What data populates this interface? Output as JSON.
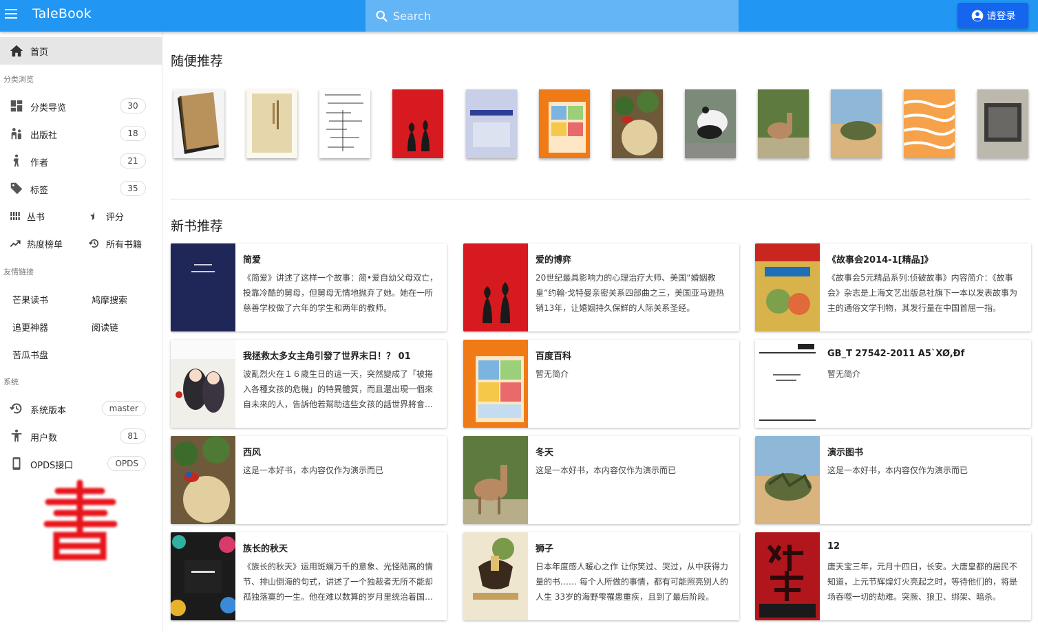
{
  "app": {
    "title": "TaleBook"
  },
  "search": {
    "placeholder": "Search"
  },
  "header": {
    "login_label": "请登录"
  },
  "sidebar": {
    "home_label": "首页",
    "browse_header": "分类浏览",
    "browse_items": [
      {
        "label": "分类导览",
        "count": "30"
      },
      {
        "label": "出版社",
        "count": "18"
      },
      {
        "label": "作者",
        "count": "21"
      },
      {
        "label": "标签",
        "count": "35"
      }
    ],
    "series_label": "丛书",
    "rating_label": "评分",
    "hot_label": "热度榜单",
    "all_books_label": "所有书籍",
    "links_header": "友情链接",
    "links": [
      "芒果读书",
      "鸠摩搜索",
      "追更神器",
      "阅读链",
      "苦瓜书盘"
    ],
    "system_header": "系统",
    "system_items": [
      {
        "label": "系统版本",
        "value": "master"
      },
      {
        "label": "用户数",
        "value": "81"
      },
      {
        "label": "OPDS接口",
        "value": "OPDS"
      }
    ],
    "seal_text": "書"
  },
  "random": {
    "title": "随便推荐",
    "covers": [
      "brown-book",
      "tan-book",
      "document-scan",
      "red-chess",
      "blue-textbook",
      "comic-almanac",
      "bird-flowers",
      "panda",
      "deer",
      "desert-plant",
      "orange-stripes",
      "grey-photo"
    ]
  },
  "newbooks": {
    "title": "新书推荐",
    "books": [
      {
        "title": "简爱",
        "desc": "《简爱》讲述了这样一个故事：简•爱自幼父母双亡，投靠冷酷的舅母，但舅母无情地抛弃了她。她在一所慈善学校做了六年的学生和两年的教师。"
      },
      {
        "title": "爱的博弈",
        "desc": "20世纪最具影响力的心理治疗大师、美国“婚姻教皇”约翰·戈特曼亲密关系四部曲之三，美国亚马逊热销13年，让婚姻持久保鲜的人际关系圣经。"
      },
      {
        "title": "《故事会2014-1[精品]》",
        "desc": "《故事会5元精品系列:侦破故事》内容简介：《故事会》杂志是上海文艺出版总社旗下一本以发表故事为主的通俗文学刊物，其发行量在中国首屈一指。"
      },
      {
        "title": "我拯救太多女主角引發了世界末日！？ 01",
        "desc": "波亂烈火在１６歲生日的這一天，突然變成了「被捲入各種女孩的危機」的特異體質，而且還出現一個來自未來的人，告訴他若幫助這些女孩的話世界將會毀滅。"
      },
      {
        "title": "百度百科",
        "desc": "暂无简介"
      },
      {
        "title": "GB_T 27542-2011 Ä5`XØ,Ðf",
        "desc": "暂无简介"
      },
      {
        "title": "西风",
        "desc": "这是一本好书，本内容仅作为演示而已"
      },
      {
        "title": "冬天",
        "desc": "这是一本好书，本内容仅作为演示而已"
      },
      {
        "title": "演示图书",
        "desc": "这是一本好书，本内容仅作为演示而已"
      },
      {
        "title": "族长的秋天",
        "desc": "《族长的秋天》运用斑斓万千的意象、光怪陆离的情节、排山倒海的句式，讲述了一个独裁者无所不能却孤独落寞的一生。他在难以数算的岁月里统治着国家。"
      },
      {
        "title": "狮子",
        "desc": "日本年度感人暖心之作 让你笑过、哭过，从中获得力量的书…… 每个人所做的事情，都有可能照亮别人的人生 33岁的海野雫罹患重疾，且到了最后阶段。"
      },
      {
        "title": "12",
        "desc": "唐天宝三年，元月十四日，长安。大唐皇都的居民不知道，上元节辉煌灯火亮起之时，等待他们的，将是场吞噬一切的劫难。突厥、狼卫、绑架、暗杀。"
      }
    ]
  },
  "colors": {
    "primary": "#2196f3",
    "search_bg": "#64b5f6",
    "login_bg": "#1565ef",
    "seal": "#e8141a"
  }
}
